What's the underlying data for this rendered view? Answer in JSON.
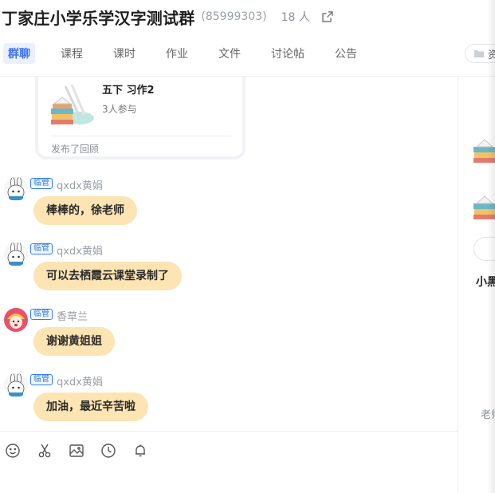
{
  "header": {
    "title": "丁家庄小学乐学汉字测试群",
    "group_id": "(85999303)",
    "member_count": "18 人",
    "external_icon": "external-link-icon"
  },
  "tabs": [
    {
      "label": "群聊",
      "active": true
    },
    {
      "label": "课程",
      "active": false
    },
    {
      "label": "课时",
      "active": false
    },
    {
      "label": "作业",
      "active": false
    },
    {
      "label": "文件",
      "active": false
    },
    {
      "label": "讨论帖",
      "active": false
    },
    {
      "label": "公告",
      "active": false
    }
  ],
  "side_button": {
    "label": "资",
    "icon": "folder-icon"
  },
  "card": {
    "title": "五下 习作2",
    "participants": "3人参与",
    "footer": "发布了回顾"
  },
  "messages": [
    {
      "badge": "临管",
      "sender": "qxdx黄娟",
      "text": "棒棒的，徐老师",
      "avatar": "rabbit-avatar"
    },
    {
      "badge": "临管",
      "sender": "qxdx黄娟",
      "text": "可以去栖霞云课堂录制了",
      "avatar": "rabbit-avatar"
    },
    {
      "badge": "临管",
      "sender": "香草兰",
      "text": "谢谢黄姐姐",
      "avatar": "girl-avatar"
    },
    {
      "badge": "临管",
      "sender": "qxdx黄娟",
      "text": "加油，最近辛苦啦",
      "avatar": "rabbit-avatar"
    }
  ],
  "toolbar": [
    "emoji-icon",
    "scissors-icon",
    "image-icon",
    "clock-icon",
    "bell-icon"
  ],
  "right_panel": {
    "name": "小黑",
    "label": "老师"
  },
  "colors": {
    "accent": "#3b6ff5",
    "bubble": "#fde4b3",
    "badge": "#2f7df6"
  }
}
